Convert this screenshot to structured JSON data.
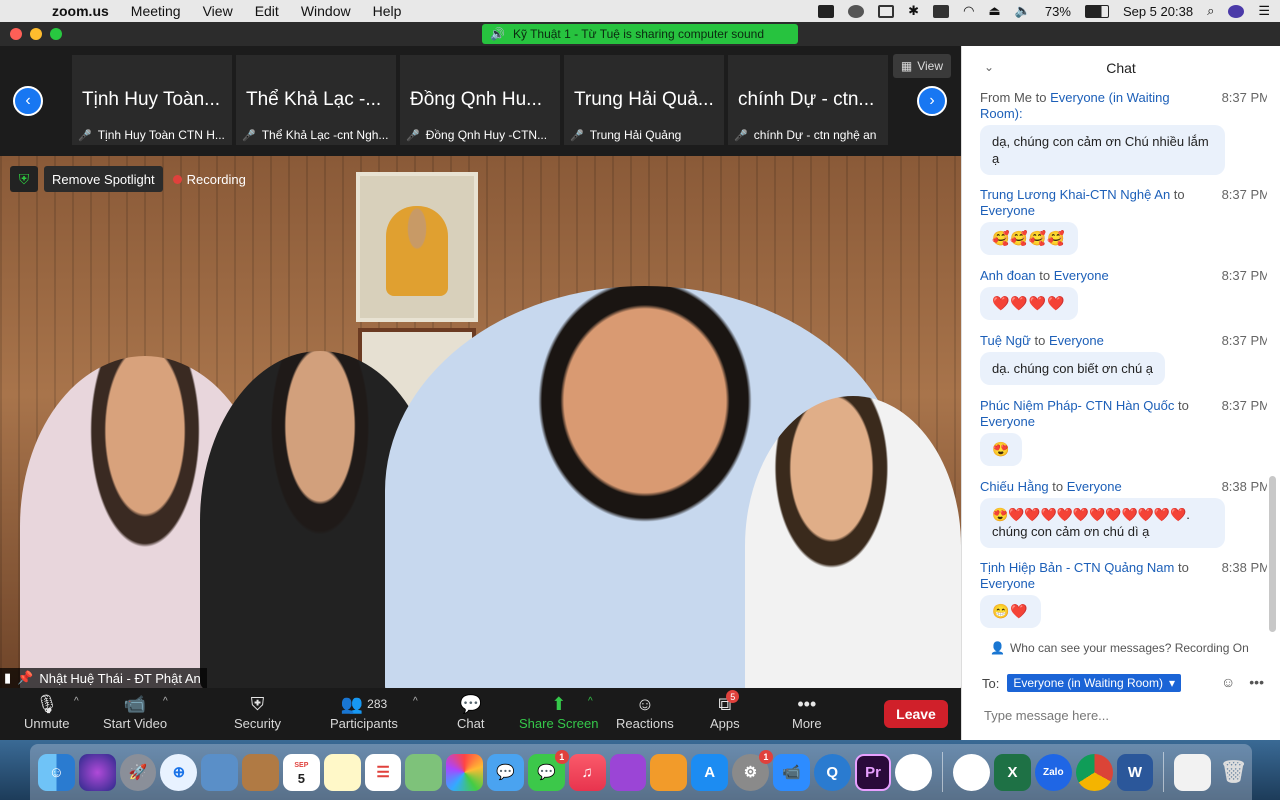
{
  "menubar": {
    "app_name": "zoom.us",
    "items": [
      "Meeting",
      "View",
      "Edit",
      "Window",
      "Help"
    ],
    "battery": "73%",
    "datetime": "Sep 5  20:38"
  },
  "titlebar": {
    "sharing_text": "Kỹ Thuật 1  - Từ Tuệ is sharing computer sound"
  },
  "gallery": {
    "view_label": "View",
    "thumbnails": [
      {
        "name": "Tịnh Huy Toàn...",
        "label": "Tịnh Huy Toàn CTN H..."
      },
      {
        "name": "Thể Khả Lạc -...",
        "label": "Thể Khả Lạc -cnt Ngh..."
      },
      {
        "name": "Đồng Qnh Hu...",
        "label": "Đồng Qnh Huy -CTN..."
      },
      {
        "name": "Trung Hải Quả...",
        "label": "Trung Hải Quảng"
      },
      {
        "name": "chính Dự - ctn...",
        "label": "chính Dự - ctn nghệ an"
      }
    ]
  },
  "video": {
    "remove_spotlight": "Remove Spotlight",
    "recording": "Recording",
    "speaker": "Nhật Huệ Thái - ĐT Phật An"
  },
  "toolbar": {
    "unmute": "Unmute",
    "start_video": "Start Video",
    "security": "Security",
    "participants": "Participants",
    "participant_count": "283",
    "chat": "Chat",
    "share_screen": "Share Screen",
    "reactions": "Reactions",
    "apps": "Apps",
    "apps_badge": "5",
    "more": "More",
    "leave": "Leave"
  },
  "chat": {
    "title": "Chat",
    "messages": [
      {
        "sender": "From Me",
        "to": "to",
        "recipient": "Everyone (in Waiting Room):",
        "time": "8:37 PM",
        "text": "dạ, chúng con cảm ơn Chú nhiều lắm ạ"
      },
      {
        "sender": "Trung Lương Khai-CTN Nghệ An",
        "to": "to",
        "recipient": "Everyone",
        "time": "8:37 PM",
        "text": "🥰🥰🥰🥰"
      },
      {
        "sender": "Anh đoan",
        "to": "to",
        "recipient": "Everyone",
        "time": "8:37 PM",
        "text": "❤️❤️❤️❤️"
      },
      {
        "sender": "Tuệ Ngữ",
        "to": "to",
        "recipient": "Everyone",
        "time": "8:37 PM",
        "text": "dạ. chúng con biết ơn chú ạ"
      },
      {
        "sender": "Phúc Niệm Pháp- CTN Hàn Quốc",
        "to": "to",
        "recipient": "Everyone",
        "time": "8:37 PM",
        "text": "😍"
      },
      {
        "sender": "Chiếu Hằng",
        "to": "to",
        "recipient": "Everyone",
        "time": "8:38 PM",
        "text": "😍❤️❤️❤️❤️❤️❤️❤️❤️❤️❤️❤️. chúng con cảm ơn chú dì ạ"
      },
      {
        "sender": "Tịnh Hiệp Bản - CTN Quảng Nam",
        "to": "to",
        "recipient": "Everyone",
        "time": "8:38 PM",
        "text": "😁❤️"
      }
    ],
    "who_can_see": "Who can see your messages? Recording On",
    "to_label": "To:",
    "to_value": "Everyone (in Waiting Room)",
    "input_placeholder": "Type message here..."
  },
  "dock": {
    "calendar_month": "SEP",
    "calendar_day": "5",
    "badges": {
      "messages": "1",
      "settings": "1"
    },
    "premiere": "Pr",
    "excel": "X",
    "zalo": "Zalo",
    "word": "W"
  }
}
